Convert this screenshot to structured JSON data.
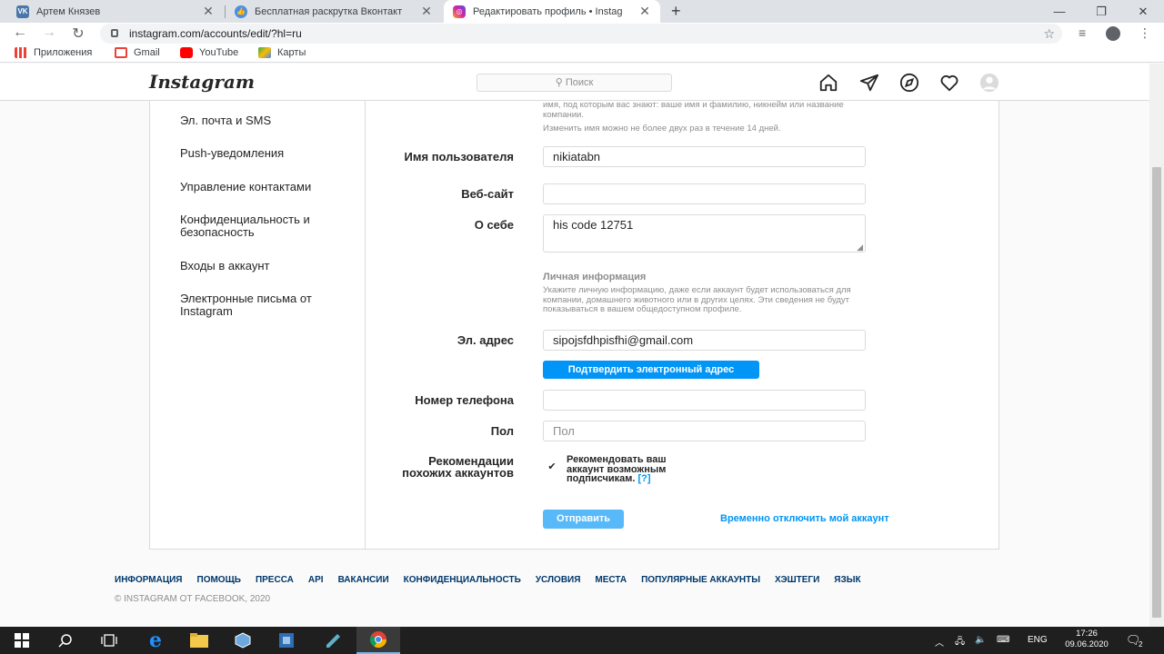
{
  "browser": {
    "tabs": [
      {
        "title": "Артем Князев",
        "icon": "vk-icon",
        "color": "#4a76a8"
      },
      {
        "title": "Бесплатная раскрутка Вконтакт",
        "icon": "like-icon",
        "color": "#4a90e2"
      },
      {
        "title": "Редактировать профиль • Instag",
        "icon": "instagram-icon",
        "color": "#d6249f"
      }
    ],
    "url": "instagram.com/accounts/edit/?hl=ru",
    "bookmarks": [
      {
        "label": "Приложения",
        "icon": "apps-icon"
      },
      {
        "label": "Gmail",
        "icon": "gmail-icon",
        "color": "#ea4335"
      },
      {
        "label": "YouTube",
        "icon": "youtube-icon",
        "color": "#ff0000"
      },
      {
        "label": "Карты",
        "icon": "maps-icon",
        "color": "#34a853"
      }
    ]
  },
  "ig": {
    "logo": "Instagram",
    "search_placeholder": "Поиск"
  },
  "sidebar": {
    "items": [
      {
        "label": "Эл. почта и SMS"
      },
      {
        "label": "Push-уведомления"
      },
      {
        "label": "Управление контактами"
      },
      {
        "label": "Конфиденциальность и безопасность"
      },
      {
        "label": "Входы в аккаунт"
      },
      {
        "label": "Электронные письма от Instagram"
      }
    ]
  },
  "form": {
    "name_help": "имя, под которым вас знают: ваше имя и фамилию, никнейм или название компании.",
    "name_limit": "Изменить имя можно не более двух раз в течение 14 дней.",
    "username_label": "Имя пользователя",
    "username_value": "nikiatabn",
    "website_label": "Веб-сайт",
    "website_value": "",
    "bio_label": "О себе",
    "bio_value": "his code 12751",
    "personal_title": "Личная информация",
    "personal_help": "Укажите личную информацию, даже если аккаунт будет использоваться для компании, домашнего животного или в других целях. Эти сведения не будут показываться в вашем общедоступном профиле.",
    "email_label": "Эл. адрес",
    "email_value": "sipojsfdhpisfhi@gmail.com",
    "confirm_email": "Подтвердить электронный адрес",
    "phone_label": "Номер телефона",
    "phone_value": "",
    "gender_label": "Пол",
    "gender_placeholder": "Пол",
    "recs_label": "Рекомендации похожих аккаунтов",
    "recs_text": "Рекомендовать ваш аккаунт возможным подписчикам.",
    "recs_help_link": "[?]",
    "recs_checked": true,
    "submit": "Отправить",
    "disable_account": "Временно отключить мой аккаунт"
  },
  "footer": {
    "links": [
      "ИНФОРМАЦИЯ",
      "ПОМОЩЬ",
      "ПРЕССА",
      "API",
      "ВАКАНСИИ",
      "КОНФИДЕНЦИАЛЬНОСТЬ",
      "УСЛОВИЯ",
      "МЕСТА",
      "ПОПУЛЯРНЫЕ АККАУНТЫ",
      "ХЭШТЕГИ",
      "ЯЗЫК"
    ],
    "copyright": "© INSTAGRAM ОТ FACEBOOK, 2020"
  },
  "taskbar": {
    "lang": "ENG",
    "time": "17:26",
    "date": "09.06.2020",
    "notif_count": "2"
  },
  "colors": {
    "accent": "#0095f6",
    "link_dark": "#00376b"
  }
}
